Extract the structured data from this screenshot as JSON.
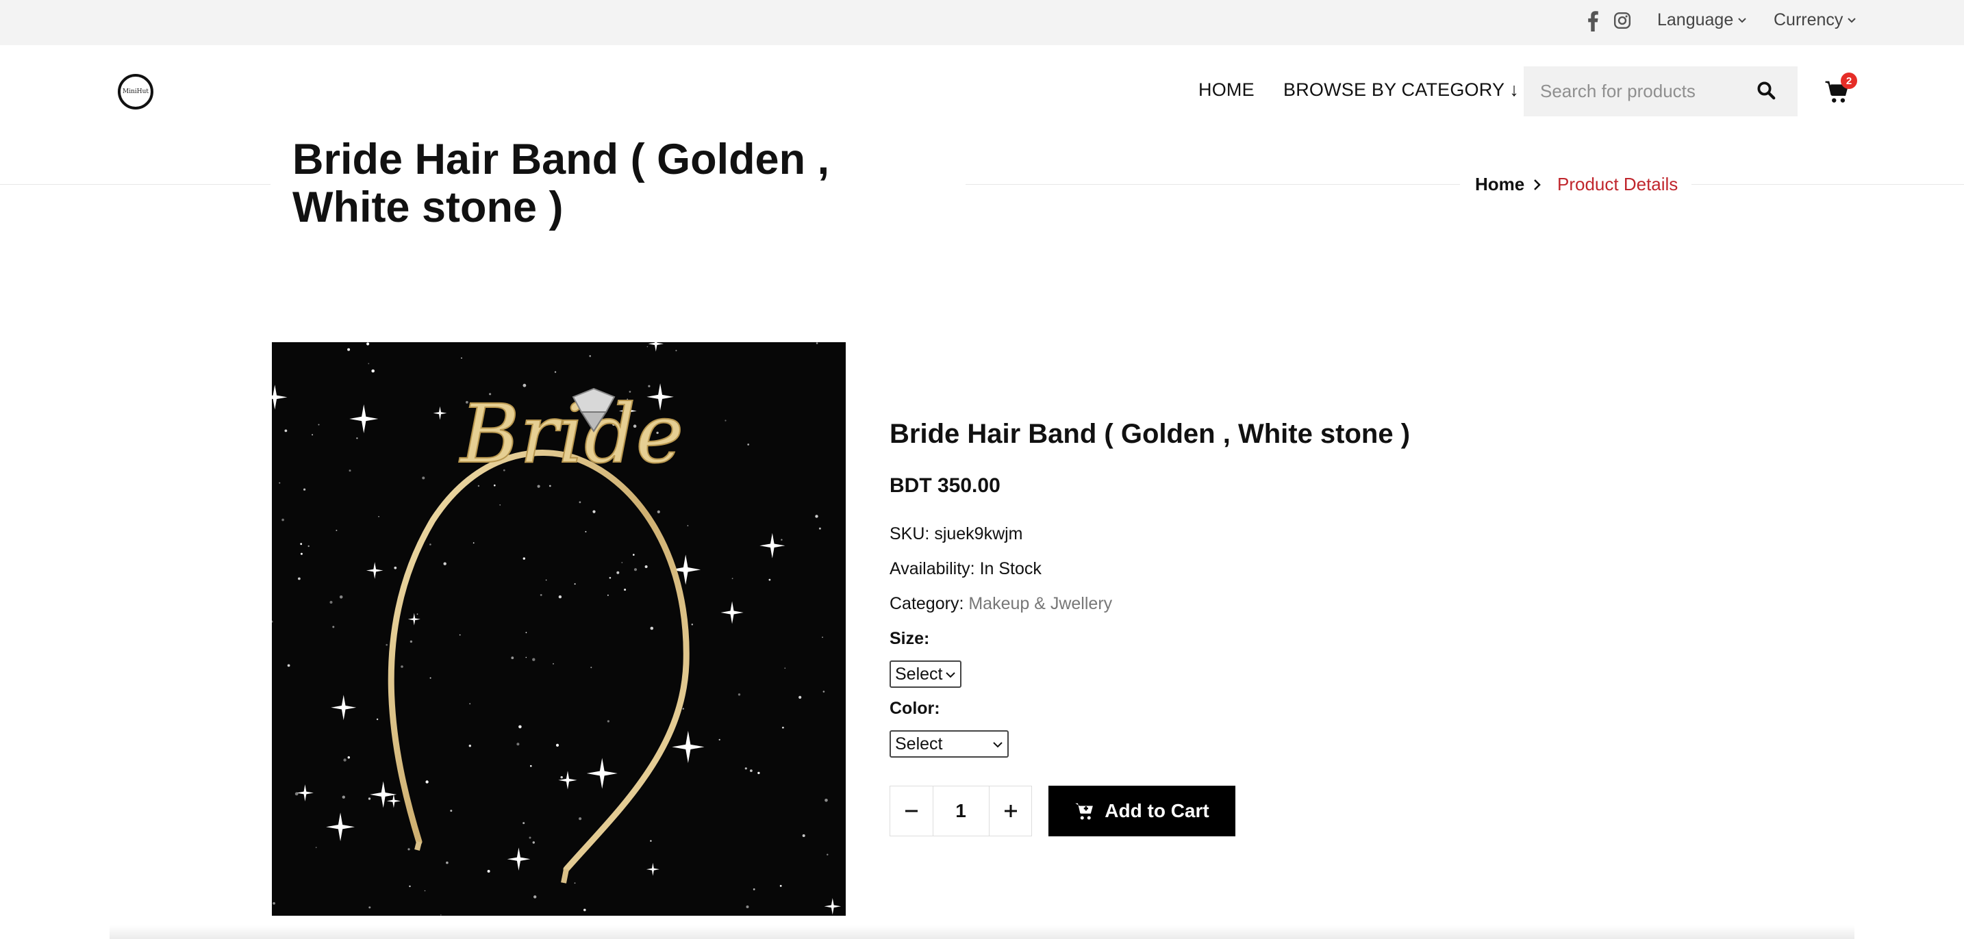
{
  "topbar": {
    "social": [
      "facebook-icon",
      "instagram-icon"
    ],
    "language_label": "Language",
    "currency_label": "Currency"
  },
  "logo": {
    "text": "MiniHut"
  },
  "nav": {
    "home": "HOME",
    "browse": "BROWSE BY CATEGORY ↓"
  },
  "search": {
    "placeholder": "Search for products"
  },
  "cart": {
    "count": "2"
  },
  "page": {
    "title": "Bride Hair Band ( Golden , White stone )",
    "breadcrumb": {
      "home": "Home",
      "current": "Product Details"
    }
  },
  "product": {
    "name": "Bride Hair Band ( Golden , White stone )",
    "price": "BDT 350.00",
    "sku_label": "SKU:",
    "sku": "sjuek9kwjm",
    "availability_label": "Availability:",
    "availability": "In Stock",
    "category_label": "Category:",
    "category": "Makeup & Jwellery",
    "size_label": "Size:",
    "size_value": "Select",
    "color_label": "Color:",
    "color_value": "Select",
    "quantity": "1",
    "add_to_cart": "Add to Cart",
    "image_text": "Bride"
  },
  "colors": {
    "accent_red": "#c0262d",
    "badge_red": "#e52d27",
    "button_black": "#000000",
    "topbar_bg": "#f3f3f3"
  }
}
